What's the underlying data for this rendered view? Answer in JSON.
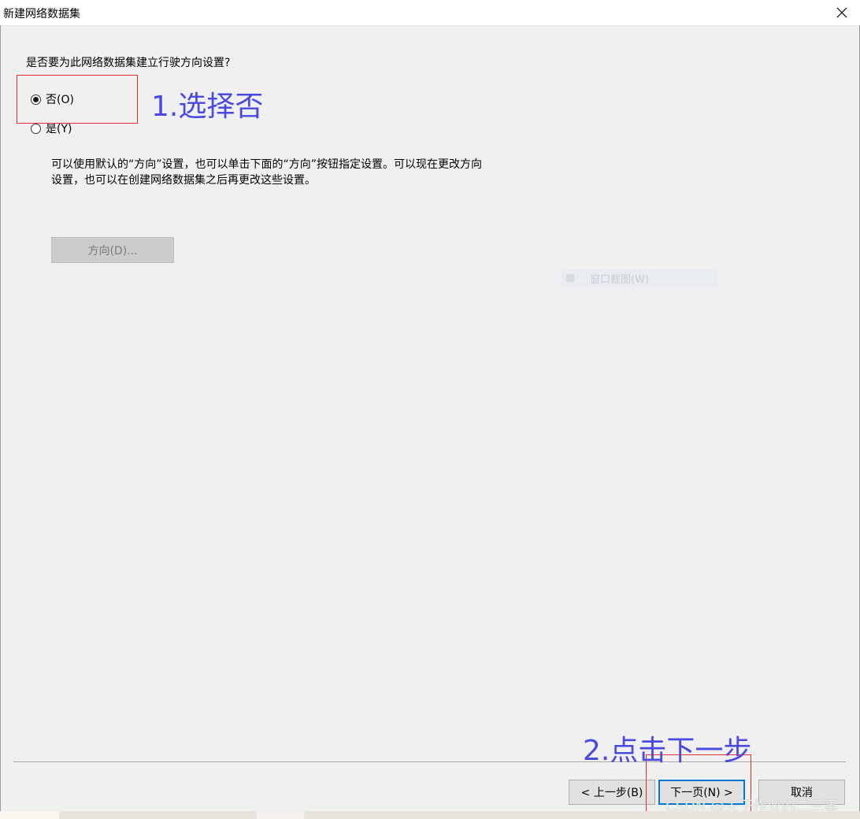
{
  "window": {
    "title": "新建网络数据集"
  },
  "prompt": {
    "question": "是否要为此网络数据集建立行驶方向设置?"
  },
  "options": [
    {
      "label": "否(O)",
      "checked": true
    },
    {
      "label": "是(Y)",
      "checked": false
    }
  ],
  "description": {
    "line1": "可以使用默认的“方向”设置，也可以单击下面的“方向”按钮指定设置。可以现在更改方向",
    "line2": "设置，也可以在创建网络数据集之后再更改这些设置。"
  },
  "directions_button": {
    "label": "方向(D)...",
    "enabled": false
  },
  "ghost_overlay": {
    "label": "窗口截图(W)"
  },
  "annotations": {
    "step1": "1.选择否",
    "step2": "2.点击下一步",
    "text_color": "#4a4ae0",
    "box_color": "#e03030"
  },
  "footer": {
    "back": "< 上一步(B)",
    "next": "下一页(N) >",
    "cancel": "取消"
  },
  "watermark": "CSDN @关于作业的二三事",
  "icons": {
    "close": "close-icon"
  }
}
